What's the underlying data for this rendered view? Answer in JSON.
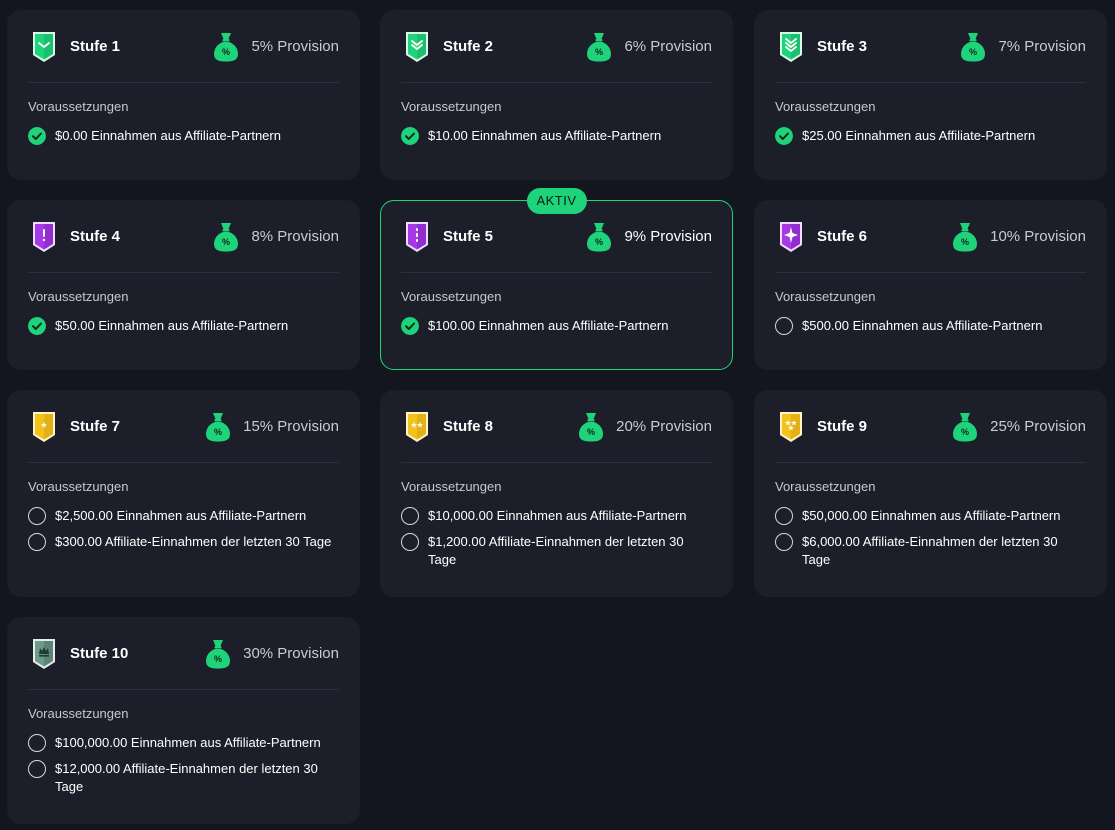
{
  "requirements_title": "Voraussetzungen",
  "active_badge": "AKTIV",
  "colors": {
    "accent": "#1fd37b",
    "card_bg": "#1c1e2a",
    "page_bg": "#13151f"
  },
  "levels": [
    {
      "name": "Stufe 1",
      "provision": "5% Provision",
      "badge_icon": "green-shield-chevron-1-icon",
      "requirements": [
        {
          "text": "$0.00 Einnahmen aus Affiliate-Partnern",
          "done": true
        }
      ]
    },
    {
      "name": "Stufe 2",
      "provision": "6% Provision",
      "badge_icon": "green-shield-chevron-2-icon",
      "requirements": [
        {
          "text": "$10.00 Einnahmen aus Affiliate-Partnern",
          "done": true
        }
      ]
    },
    {
      "name": "Stufe 3",
      "provision": "7% Provision",
      "badge_icon": "green-shield-chevron-3-icon",
      "requirements": [
        {
          "text": "$25.00 Einnahmen aus Affiliate-Partnern",
          "done": true
        }
      ]
    },
    {
      "name": "Stufe 4",
      "provision": "8% Provision",
      "badge_icon": "purple-shield-1-icon",
      "requirements": [
        {
          "text": "$50.00 Einnahmen aus Affiliate-Partnern",
          "done": true
        }
      ]
    },
    {
      "name": "Stufe 5",
      "provision": "9% Provision",
      "badge_icon": "purple-shield-2-icon",
      "active": true,
      "requirements": [
        {
          "text": "$100.00 Einnahmen aus Affiliate-Partnern",
          "done": true
        }
      ]
    },
    {
      "name": "Stufe 6",
      "provision": "10% Provision",
      "badge_icon": "purple-shield-star-icon",
      "requirements": [
        {
          "text": "$500.00 Einnahmen aus Affiliate-Partnern",
          "done": false
        }
      ]
    },
    {
      "name": "Stufe 7",
      "provision": "15% Provision",
      "badge_icon": "gold-shield-1-star-icon",
      "requirements": [
        {
          "text": "$2,500.00 Einnahmen aus Affiliate-Partnern",
          "done": false
        },
        {
          "text": "$300.00 Affiliate-Einnahmen der letzten 30 Tage",
          "done": false
        }
      ]
    },
    {
      "name": "Stufe 8",
      "provision": "20% Provision",
      "badge_icon": "gold-shield-2-star-icon",
      "requirements": [
        {
          "text": "$10,000.00 Einnahmen aus Affiliate-Partnern",
          "done": false
        },
        {
          "text": "$1,200.00 Affiliate-Einnahmen der letzten 30 Tage",
          "done": false
        }
      ]
    },
    {
      "name": "Stufe 9",
      "provision": "25% Provision",
      "badge_icon": "gold-shield-3-star-icon",
      "requirements": [
        {
          "text": "$50,000.00 Einnahmen aus Affiliate-Partnern",
          "done": false
        },
        {
          "text": "$6,000.00 Affiliate-Einnahmen der letzten 30 Tage",
          "done": false
        }
      ]
    },
    {
      "name": "Stufe 10",
      "provision": "30% Provision",
      "badge_icon": "silver-shield-crown-icon",
      "requirements": [
        {
          "text": "$100,000.00 Einnahmen aus Affiliate-Partnern",
          "done": false
        },
        {
          "text": "$12,000.00 Affiliate-Einnahmen der letzten 30 Tage",
          "done": false
        }
      ]
    }
  ]
}
